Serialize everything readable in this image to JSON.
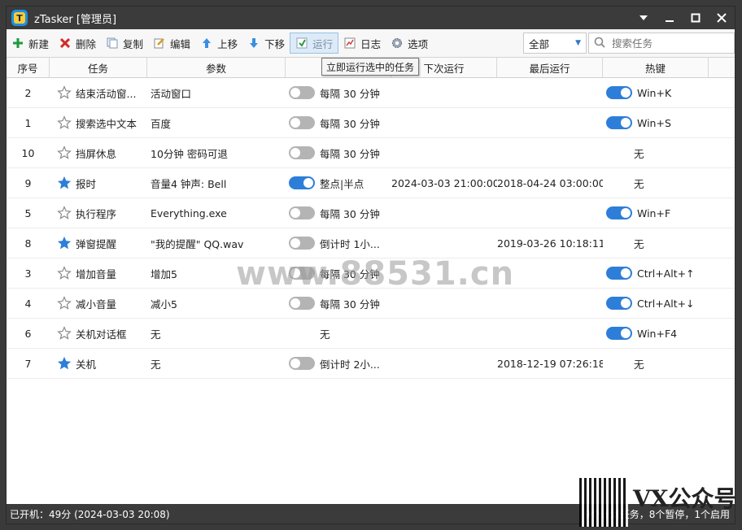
{
  "window": {
    "title": "zTasker [管理员]"
  },
  "toolbar": {
    "new_label": "新建",
    "delete_label": "删除",
    "copy_label": "复制",
    "edit_label": "编辑",
    "up_label": "上移",
    "down_label": "下移",
    "run_label": "运行",
    "log_label": "日志",
    "options_label": "选项",
    "filter_value": "全部",
    "search_placeholder": "搜索任务"
  },
  "columns": {
    "no": "序号",
    "task": "任务",
    "param": "参数",
    "next": "下次运行",
    "last": "最后运行",
    "hotkey": "热键"
  },
  "tooltip": "立即运行选中的任务",
  "rows": [
    {
      "no": "2",
      "starred": false,
      "task": "结束活动窗...",
      "param": "活动窗口",
      "enabled": false,
      "schedule": "每隔 30 分钟",
      "next": "",
      "last": "",
      "hotkey_on": true,
      "hotkey": "Win+K"
    },
    {
      "no": "1",
      "starred": false,
      "task": "搜索选中文本",
      "param": "百度",
      "enabled": false,
      "schedule": "每隔 30 分钟",
      "next": "",
      "last": "",
      "hotkey_on": true,
      "hotkey": "Win+S"
    },
    {
      "no": "10",
      "starred": false,
      "task": "挡屏休息",
      "param": "10分钟 密码可退",
      "enabled": false,
      "schedule": "每隔 30 分钟",
      "next": "",
      "last": "",
      "hotkey_on": null,
      "hotkey": "无"
    },
    {
      "no": "9",
      "starred": true,
      "task": "报时",
      "param": "音量4 钟声: Bell",
      "enabled": true,
      "schedule": "整点|半点",
      "next": "2024-03-03 21:00:00",
      "last": "2018-04-24 03:00:00",
      "hotkey_on": null,
      "hotkey": "无"
    },
    {
      "no": "5",
      "starred": false,
      "task": "执行程序",
      "param": "Everything.exe",
      "enabled": false,
      "schedule": "每隔 30 分钟",
      "next": "",
      "last": "",
      "hotkey_on": true,
      "hotkey": "Win+F"
    },
    {
      "no": "8",
      "starred": true,
      "task": "弹窗提醒",
      "param": "\"我的提醒\" QQ.wav",
      "enabled": false,
      "schedule": "倒计时 1小...",
      "next": "",
      "last": "2019-03-26 10:18:11",
      "hotkey_on": null,
      "hotkey": "无"
    },
    {
      "no": "3",
      "starred": false,
      "task": "增加音量",
      "param": "增加5",
      "enabled": false,
      "schedule": "每隔 30 分钟",
      "next": "",
      "last": "",
      "hotkey_on": true,
      "hotkey": "Ctrl+Alt+↑"
    },
    {
      "no": "4",
      "starred": false,
      "task": "减小音量",
      "param": "减小5",
      "enabled": false,
      "schedule": "每隔 30 分钟",
      "next": "",
      "last": "",
      "hotkey_on": true,
      "hotkey": "Ctrl+Alt+↓"
    },
    {
      "no": "6",
      "starred": false,
      "task": "关机对话框",
      "param": "无",
      "enabled": null,
      "schedule": "无",
      "next": "",
      "last": "",
      "hotkey_on": true,
      "hotkey": "Win+F4"
    },
    {
      "no": "7",
      "starred": true,
      "task": "关机",
      "param": "无",
      "enabled": false,
      "schedule": "倒计时 2小...",
      "next": "",
      "last": "2018-12-19 07:26:18",
      "hotkey_on": null,
      "hotkey": "无"
    }
  ],
  "status": {
    "uptime": "已开机：49分 (2024-03-03 20:08)",
    "summary": "9个计划任务，8个暂停，1个启用"
  },
  "watermark": "www.88531.cn",
  "overlay_text": "VX公众号",
  "colors": {
    "accent": "#2d7ed8",
    "titlebar": "#3b3b3b",
    "toggle_off": "#b4b4b4"
  }
}
